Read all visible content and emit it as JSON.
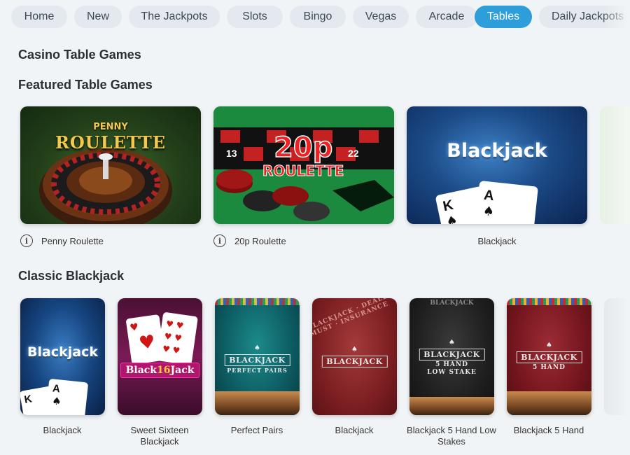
{
  "nav": {
    "items": [
      {
        "label": "Home",
        "active": false
      },
      {
        "label": "New",
        "active": false
      },
      {
        "label": "The Jackpots",
        "active": false
      },
      {
        "label": "Slots",
        "active": false
      },
      {
        "label": "Bingo",
        "active": false
      },
      {
        "label": "Vegas",
        "active": false
      },
      {
        "label": "Arcade",
        "active": false
      },
      {
        "label": "Tables",
        "active": true
      },
      {
        "label": "Daily Jackpots",
        "active": false
      }
    ]
  },
  "page_title": "Casino Table Games",
  "featured": {
    "heading": "Featured Table Games",
    "games": [
      {
        "title": "Penny Roulette",
        "has_info": true,
        "art_logo": "PENNY ROULETTE"
      },
      {
        "title": "20p Roulette",
        "has_info": true,
        "art_logo": "20p ROULETTE"
      },
      {
        "title": "Blackjack",
        "has_info": false,
        "art_logo": "Blackjack"
      }
    ]
  },
  "classic": {
    "heading": "Classic Blackjack",
    "games": [
      {
        "title": "Blackjack",
        "art_logo": "Blackjack"
      },
      {
        "title": "Sweet Sixteen Blackjack",
        "art_logo": "Black 16 Jack"
      },
      {
        "title": "Perfect Pairs",
        "art_logo": "BLACKJACK"
      },
      {
        "title": "Blackjack",
        "art_logo": "BLACKJACK"
      },
      {
        "title": "Blackjack 5 Hand Low Stakes",
        "art_logo": "BLACKJACK 5 HAND LOW STAKE"
      },
      {
        "title": "Blackjack 5 Hand",
        "art_logo": "BLACKJACK 5 HAND"
      }
    ]
  },
  "colors": {
    "accent": "#2d9ed9",
    "pill_bg": "#e3e9ee",
    "page_bg": "#f1f4f6"
  },
  "icons": {
    "info": "info-icon"
  }
}
